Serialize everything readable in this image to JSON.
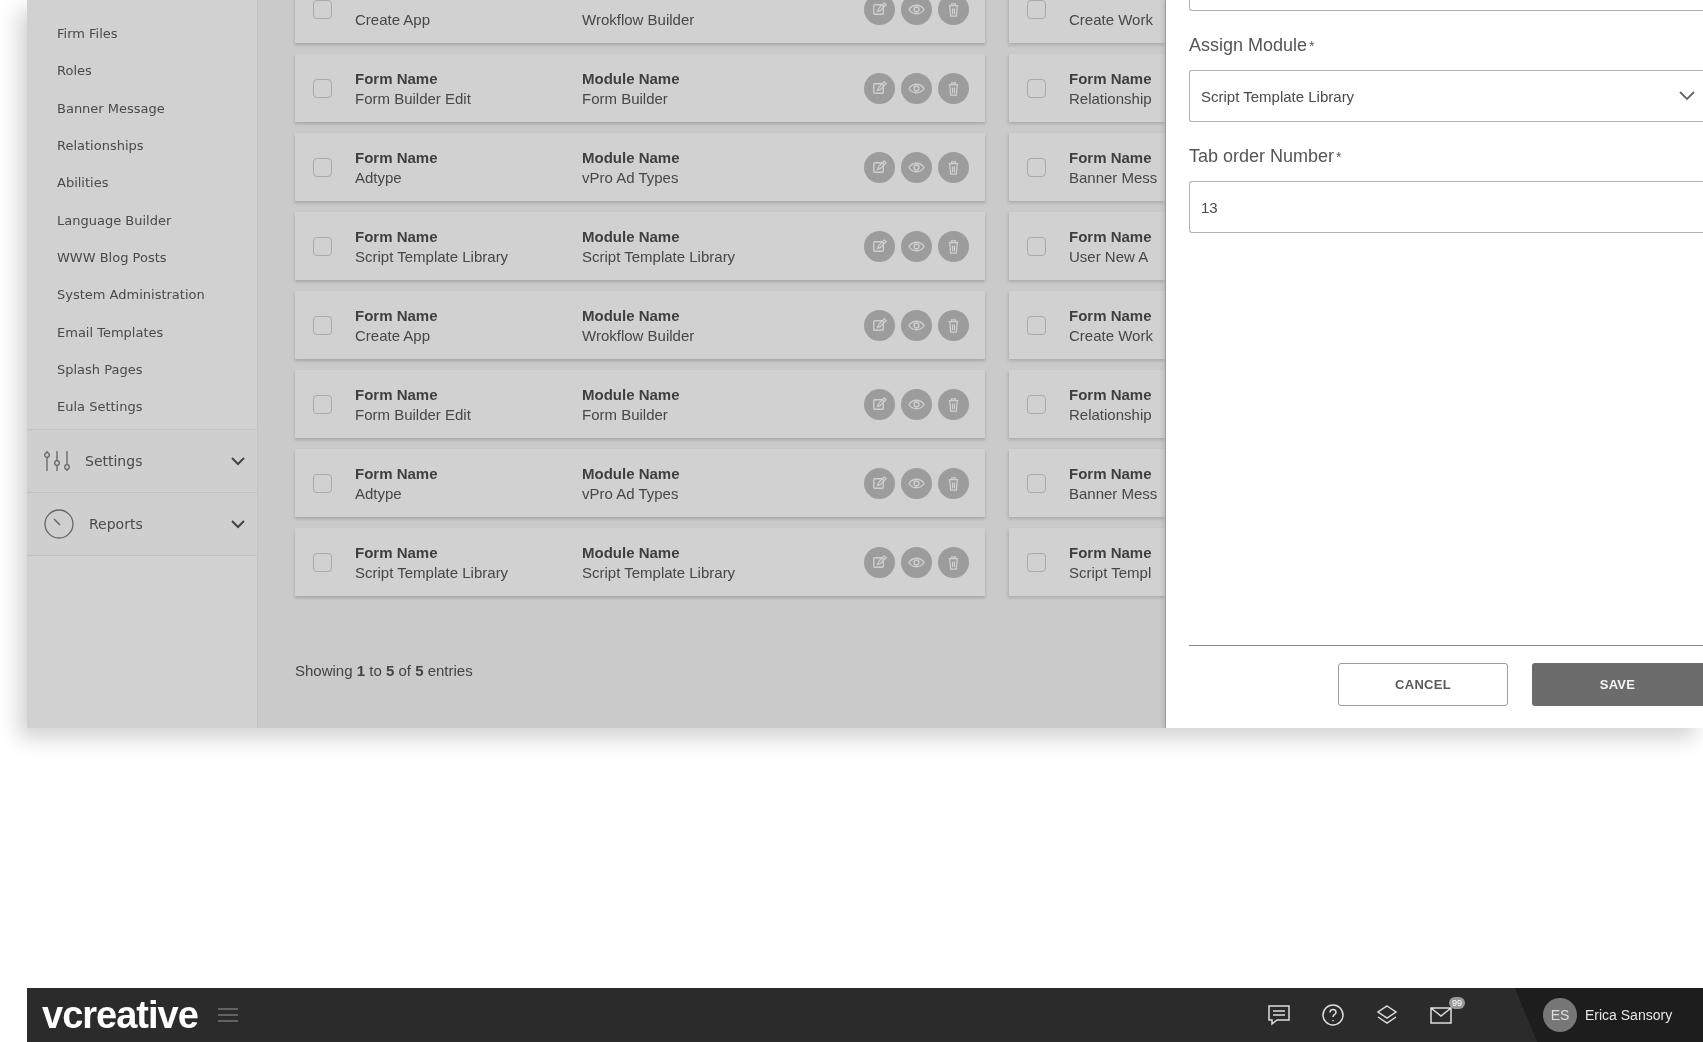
{
  "sidebar": {
    "items": [
      "Firm Files",
      "Roles",
      "Banner Message",
      "Relationships",
      "Abilities",
      "Language Builder",
      "WWW Blog Posts",
      "System Administration",
      "Email Templates",
      "Splash Pages",
      "Eula Settings"
    ],
    "sections": [
      {
        "label": "Settings",
        "kind": "settings"
      },
      {
        "label": "Reports",
        "kind": "reports"
      }
    ]
  },
  "list": {
    "left_rows": [
      {
        "form": "Create App",
        "module": "Wrokflow Builder",
        "checked": false
      },
      {
        "form_label": "Form Name",
        "form": "Form Builder Edit",
        "module_label": "Module Name",
        "module": "Form Builder",
        "checked": false
      },
      {
        "form_label": "Form Name",
        "form": "Adtype",
        "module_label": "Module Name",
        "module": "vPro Ad Types",
        "checked": false
      },
      {
        "form_label": "Form Name",
        "form": "Script Template Library",
        "module_label": "Module Name",
        "module": "Script Template Library",
        "checked": false
      },
      {
        "form_label": "Form Name",
        "form": "Create App",
        "module_label": "Module Name",
        "module": "Wrokflow Builder",
        "checked": false
      },
      {
        "form_label": "Form Name",
        "form": "Form Builder Edit",
        "module_label": "Module Name",
        "module": "Form Builder",
        "checked": false
      },
      {
        "form_label": "Form Name",
        "form": "Adtype",
        "module_label": "Module Name",
        "module": "vPro Ad Types",
        "checked": false
      },
      {
        "form_label": "Form Name",
        "form": "Script Template Library",
        "module_label": "Module Name",
        "module": "Script Template Library",
        "checked": false
      }
    ],
    "right_rows": [
      {
        "form": "Create Work",
        "checked": false
      },
      {
        "form_label": "Form Name",
        "form": "Relationship",
        "checked": false
      },
      {
        "form_label": "Form Name",
        "form": "Banner Mess",
        "checked": false
      },
      {
        "form_label": "Form Name",
        "form": "User New A",
        "checked": false
      },
      {
        "form_label": "Form Name",
        "form": "Create Work",
        "checked": false
      },
      {
        "form_label": "Form Name",
        "form": "Relationship",
        "checked": false
      },
      {
        "form_label": "Form Name",
        "form": "Banner Mess",
        "checked": false
      },
      {
        "form_label": "Form Name",
        "form": "Script Templ",
        "checked": false
      }
    ],
    "footer": "Showing **1** to **5** of **5** entries"
  },
  "panel": {
    "fields": [
      {
        "label": "Assign Module",
        "required_mark": "*",
        "kind": "select",
        "value": "Script Template Library"
      },
      {
        "label": "Tab order Number",
        "required_mark": "*",
        "kind": "text",
        "value": "13"
      }
    ],
    "buttons": [
      {
        "label": "CANCEL",
        "kind": "secondary"
      },
      {
        "label": "SAVE",
        "kind": "primary"
      }
    ]
  },
  "top_bar": {
    "logo": "vcreative",
    "mail_badge": "99",
    "user_initials": "ES",
    "user_name": "Erica Sansory"
  }
}
